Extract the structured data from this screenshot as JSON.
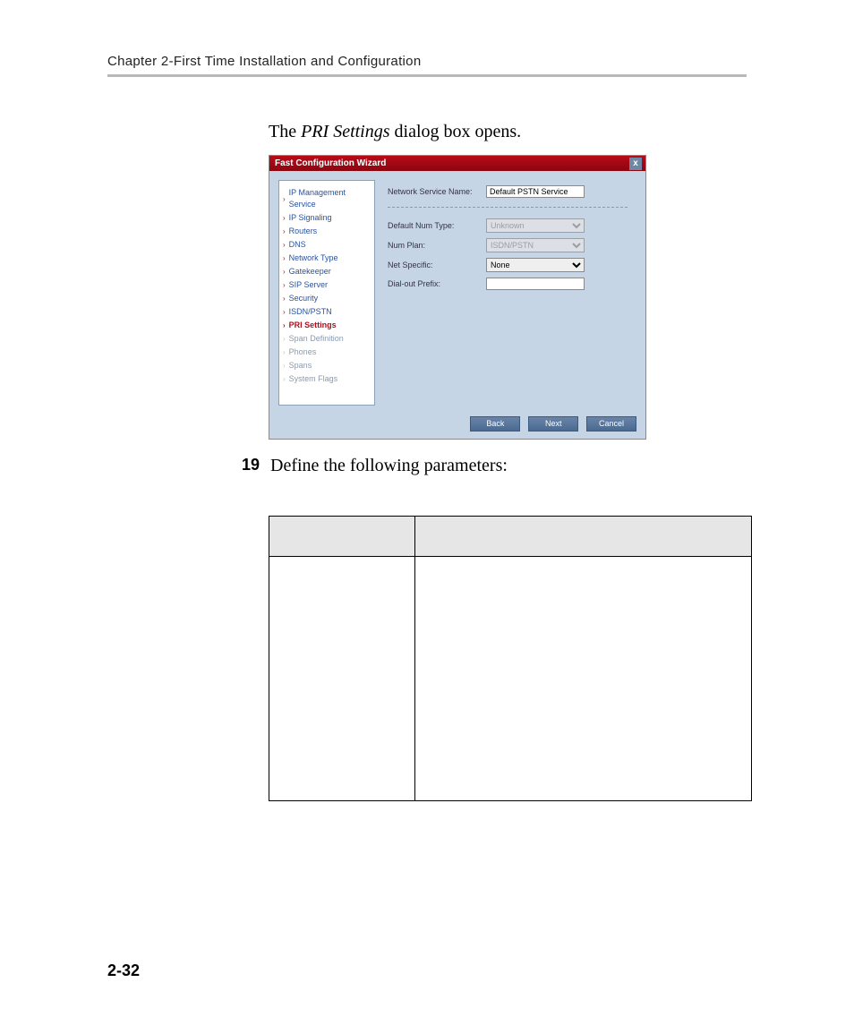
{
  "header": {
    "chapter": "Chapter 2-First Time Installation and Configuration"
  },
  "intro": {
    "prefix": "The ",
    "emph": "PRI Settings",
    "suffix": " dialog box opens."
  },
  "wizard": {
    "title": "Fast Configuration Wizard",
    "nav": [
      "IP Management Service",
      "IP Signaling",
      "Routers",
      "DNS",
      "Network Type",
      "Gatekeeper",
      "SIP Server",
      "Security",
      "ISDN/PSTN",
      "PRI Settings",
      "Span Definition",
      "Phones",
      "Spans",
      "System Flags"
    ],
    "current_index": 9,
    "muted_start": 10,
    "fields": {
      "service_name_label": "Network Service Name:",
      "service_name_value": "Default PSTN Service",
      "default_num_type_label": "Default Num Type:",
      "default_num_type_value": "Unknown",
      "num_plan_label": "Num Plan:",
      "num_plan_value": "ISDN/PSTN",
      "net_specific_label": "Net Specific:",
      "net_specific_value": "None",
      "dial_out_prefix_label": "Dial-out Prefix:",
      "dial_out_prefix_value": ""
    },
    "buttons": {
      "back": "Back",
      "next": "Next",
      "cancel": "Cancel"
    }
  },
  "step": {
    "number": "19",
    "text": "Define the following parameters:"
  },
  "page_number": "2-32"
}
